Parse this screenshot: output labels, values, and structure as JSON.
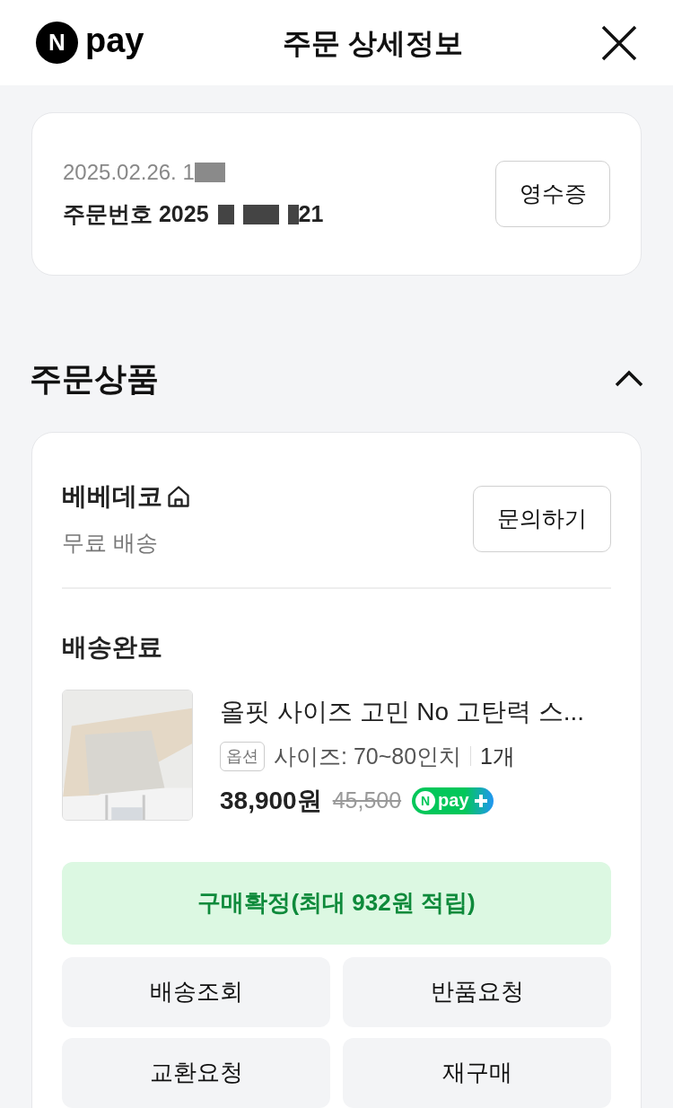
{
  "header": {
    "logo_letter": "N",
    "logo_text": "pay",
    "title": "주문 상세정보"
  },
  "order": {
    "date": "2025.02.26. 1",
    "number_label": "주문번호",
    "number_start": "2025",
    "number_end": "21",
    "receipt_button": "영수증"
  },
  "section": {
    "title": "주문상품",
    "expanded": true
  },
  "seller": {
    "name": "베베데코",
    "shipping": "무료 배송",
    "inquiry_button": "문의하기"
  },
  "status": "배송완료",
  "product": {
    "kind": "picture",
    "name": "올핏 사이즈 고민 No 고탄력 스...",
    "option_tag": "옵션",
    "option": "사이즈: 70~80인치",
    "quantity": "1개",
    "price": "38,900원",
    "original_price": "45,500",
    "badge_letter": "N",
    "badge_text": "pay"
  },
  "confirm_button": "구매확정(최대 932원 적립)",
  "actions": [
    "배송조회",
    "반품요청",
    "교환요청",
    "재구매"
  ]
}
